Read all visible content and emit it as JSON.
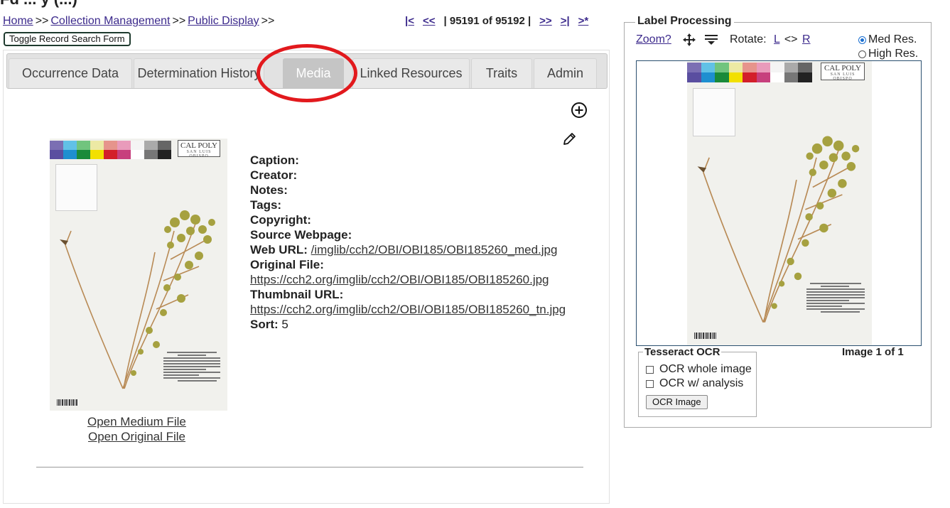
{
  "header": {
    "title_partial": "Fd ... y (...)"
  },
  "breadcrumb": {
    "items": [
      {
        "label": "Home",
        "link": true
      },
      {
        "label": "Collection Management",
        "link": true
      },
      {
        "label": "Public Display",
        "link": true
      }
    ],
    "separator": ">>"
  },
  "record_nav": {
    "first": "|<",
    "prev": "<<",
    "count": "| 95191 of 95192 |",
    "next": ">>",
    "last": ">|",
    "new": ">*"
  },
  "toggle_button": "Toggle Record Search Form",
  "tabs": [
    {
      "label": "Occurrence Data",
      "active": false
    },
    {
      "label": "Determination History",
      "active": false
    },
    {
      "label": "Media",
      "active": true
    },
    {
      "label": "Linked Resources",
      "active": false
    },
    {
      "label": "Traits",
      "active": false
    },
    {
      "label": "Admin",
      "active": false
    }
  ],
  "icons": {
    "add": "add-circle-icon",
    "edit": "pencil-icon",
    "move": "move-arrows-icon",
    "filter": "filter-lines-icon"
  },
  "media": {
    "open_medium": "Open Medium File",
    "open_original": "Open Original File",
    "fields": {
      "caption_label": "Caption:",
      "creator_label": "Creator:",
      "notes_label": "Notes:",
      "tags_label": "Tags:",
      "copyright_label": "Copyright:",
      "source_label": "Source Webpage:",
      "web_url_label": "Web URL:",
      "web_url_value": "/imglib/cch2/OBI/OBI185/OBI185260_med.jpg",
      "original_label": "Original File:",
      "original_value": "https://cch2.org/imglib/cch2/OBI/OBI185/OBI185260.jpg",
      "thumb_label": "Thumbnail URL:",
      "thumb_value": "https://cch2.org/imglib/cch2/OBI/OBI185/OBI185260_tn.jpg",
      "sort_label": "Sort:",
      "sort_value": "5"
    }
  },
  "specimen": {
    "logo": "CAL POLY",
    "logo_sub": "SAN LUIS OBISPO",
    "colors": [
      "#6b5ea8",
      "#3a9bd6",
      "#2e9a4f",
      "#f2e34b",
      "#d8344a",
      "#d86ea8",
      "#ffffff",
      "#8a8a8a",
      "#4a4a4a"
    ]
  },
  "label_processing": {
    "legend": "Label Processing",
    "zoom": "Zoom?",
    "rotate_label": "Rotate:",
    "rotate_left": "L",
    "rotate_sep": "<>",
    "rotate_right": "R",
    "res_med": "Med Res.",
    "res_high": "High Res.",
    "res_selected": "med",
    "ocr_legend": "Tesseract OCR",
    "ocr_whole": "OCR whole image",
    "ocr_analysis": "OCR w/ analysis",
    "ocr_button": "OCR Image",
    "image_count": "Image 1 of 1"
  }
}
